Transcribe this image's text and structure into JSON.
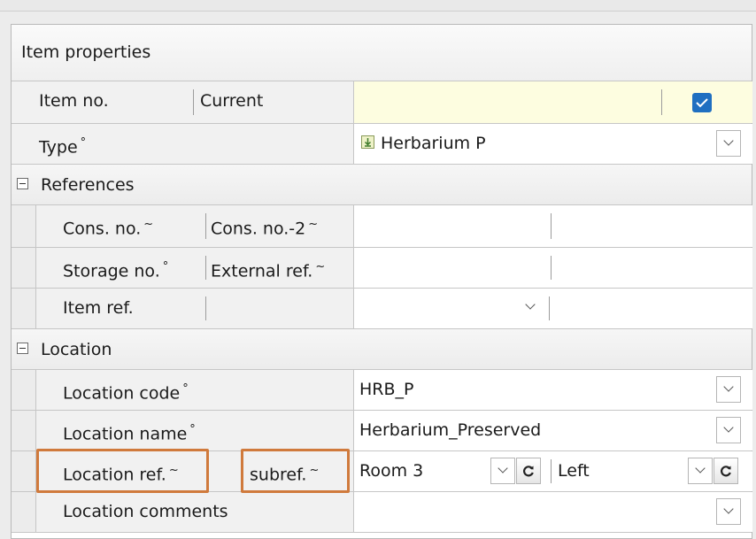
{
  "panel": {
    "title": "Item properties"
  },
  "rows": {
    "item_no": {
      "label": "Item no.",
      "sublabel": "Current",
      "value": "",
      "checked": true
    },
    "type": {
      "label": "Type",
      "marker": "°",
      "value": "Herbarium P"
    },
    "references": {
      "title": "References",
      "cons_no": {
        "label": "Cons. no.",
        "marker": "~",
        "sublabel": "Cons. no.-2",
        "sub_marker": "~",
        "value1": "",
        "value2": ""
      },
      "storage_no": {
        "label": "Storage no.",
        "marker": "°",
        "sublabel": "External ref.",
        "sub_marker": "~",
        "value1": "",
        "value2": ""
      },
      "item_ref": {
        "label": "Item ref.",
        "value1": "",
        "value2": ""
      }
    },
    "location": {
      "title": "Location",
      "code": {
        "label": "Location code",
        "marker": "°",
        "value": "HRB_P"
      },
      "name": {
        "label": "Location name",
        "marker": "°",
        "value": "Herbarium_Preserved"
      },
      "ref": {
        "label": "Location ref.",
        "marker": "~",
        "sublabel": "subref.",
        "sub_marker": "~",
        "value1": "Room 3",
        "value2": "Left"
      },
      "comments": {
        "label": "Location comments",
        "value": ""
      }
    }
  },
  "colors": {
    "highlight": "#d07a3c",
    "current_bg": "#fdfde0",
    "checkbox": "#1f6fc1"
  },
  "icons": [
    "collapse-icon",
    "chevron-down-icon",
    "refresh-icon",
    "checkbox-checked-icon",
    "herbarium-type-icon"
  ]
}
